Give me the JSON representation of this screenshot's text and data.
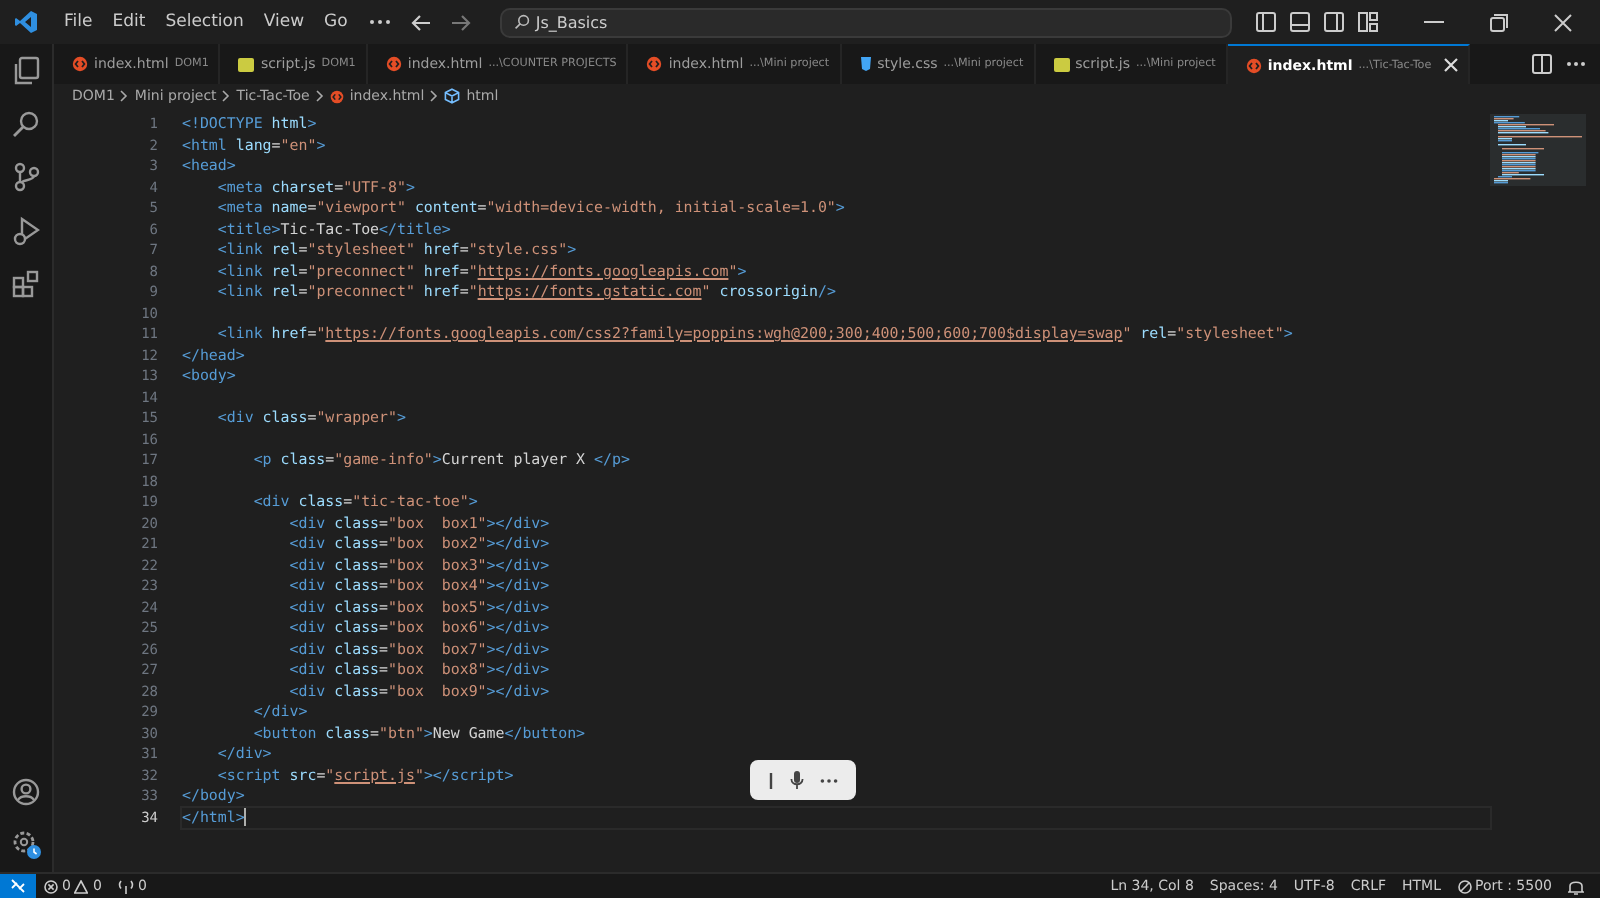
{
  "title_bar": {
    "menus": [
      "File",
      "Edit",
      "Selection",
      "View",
      "Go"
    ],
    "search": {
      "value": "Js_Basics"
    }
  },
  "tabs": [
    {
      "kind": "html",
      "name": "index.html",
      "description": "DOM1",
      "selected": false
    },
    {
      "kind": "js",
      "name": "script.js",
      "description": "DOM1",
      "selected": false
    },
    {
      "kind": "html",
      "name": "index.html",
      "description": "...\\COUNTER PROJECTS",
      "selected": false
    },
    {
      "kind": "html",
      "name": "index.html",
      "description": "...\\Mini project",
      "selected": false
    },
    {
      "kind": "css",
      "name": "style.css",
      "description": "...\\Mini project",
      "selected": false
    },
    {
      "kind": "js",
      "name": "script.js",
      "description": "...\\Mini project",
      "selected": false
    },
    {
      "kind": "html",
      "name": "index.html",
      "description": "...\\Tic-Tac-Toe",
      "selected": true
    }
  ],
  "breadcrumb": [
    {
      "kind": "folder",
      "label": "DOM1"
    },
    {
      "kind": "folder",
      "label": "Mini project"
    },
    {
      "kind": "folder",
      "label": "Tic-Tac-Toe"
    },
    {
      "kind": "html",
      "label": "index.html"
    },
    {
      "kind": "symbol",
      "label": "html"
    }
  ],
  "editor": {
    "lines": [
      {
        "number": "1",
        "current": false,
        "tokens": [
          {
            "kind": "tag",
            "text": "<!DOCTYPE"
          },
          {
            "kind": "attr",
            "text": " html"
          },
          {
            "kind": "tag",
            "text": ">"
          }
        ]
      },
      {
        "number": "2",
        "current": false,
        "tokens": [
          {
            "kind": "tag",
            "text": "<html"
          },
          {
            "kind": "attr",
            "text": " lang"
          },
          {
            "kind": "text",
            "text": "="
          },
          {
            "kind": "str",
            "text": "\"en\""
          },
          {
            "kind": "tag",
            "text": ">"
          }
        ]
      },
      {
        "number": "3",
        "current": false,
        "tokens": [
          {
            "kind": "tag",
            "text": "<head>"
          }
        ]
      },
      {
        "number": "4",
        "current": false,
        "tokens": [
          {
            "kind": "tag",
            "text": "    <meta"
          },
          {
            "kind": "attr",
            "text": " charset"
          },
          {
            "kind": "text",
            "text": "="
          },
          {
            "kind": "str",
            "text": "\"UTF-8\""
          },
          {
            "kind": "tag",
            "text": ">"
          }
        ]
      },
      {
        "number": "5",
        "current": false,
        "tokens": [
          {
            "kind": "tag",
            "text": "    <meta"
          },
          {
            "kind": "attr",
            "text": " name"
          },
          {
            "kind": "text",
            "text": "="
          },
          {
            "kind": "str",
            "text": "\"viewport\""
          },
          {
            "kind": "attr",
            "text": " content"
          },
          {
            "kind": "text",
            "text": "="
          },
          {
            "kind": "str",
            "text": "\"width=device-width, initial-scale=1.0\""
          },
          {
            "kind": "tag",
            "text": ">"
          }
        ]
      },
      {
        "number": "6",
        "current": false,
        "tokens": [
          {
            "kind": "tag",
            "text": "    <title>"
          },
          {
            "kind": "text",
            "text": "Tic-Tac-Toe"
          },
          {
            "kind": "tag",
            "text": "</title>"
          }
        ]
      },
      {
        "number": "7",
        "current": false,
        "tokens": [
          {
            "kind": "tag",
            "text": "    <link"
          },
          {
            "kind": "attr",
            "text": " rel"
          },
          {
            "kind": "text",
            "text": "="
          },
          {
            "kind": "str",
            "text": "\"stylesheet\""
          },
          {
            "kind": "attr",
            "text": " href"
          },
          {
            "kind": "text",
            "text": "="
          },
          {
            "kind": "str",
            "text": "\"style.css\""
          },
          {
            "kind": "tag",
            "text": ">"
          }
        ]
      },
      {
        "number": "8",
        "current": false,
        "tokens": [
          {
            "kind": "tag",
            "text": "    <link"
          },
          {
            "kind": "attr",
            "text": " rel"
          },
          {
            "kind": "text",
            "text": "="
          },
          {
            "kind": "str",
            "text": "\"preconnect\""
          },
          {
            "kind": "attr",
            "text": " href"
          },
          {
            "kind": "text",
            "text": "="
          },
          {
            "kind": "str",
            "text": "\""
          },
          {
            "kind": "link",
            "text": "https://fonts.googleapis.com"
          },
          {
            "kind": "str",
            "text": "\""
          },
          {
            "kind": "tag",
            "text": ">"
          }
        ]
      },
      {
        "number": "9",
        "current": false,
        "tokens": [
          {
            "kind": "tag",
            "text": "    <link"
          },
          {
            "kind": "attr",
            "text": " rel"
          },
          {
            "kind": "text",
            "text": "="
          },
          {
            "kind": "str",
            "text": "\"preconnect\""
          },
          {
            "kind": "attr",
            "text": " href"
          },
          {
            "kind": "text",
            "text": "="
          },
          {
            "kind": "str",
            "text": "\""
          },
          {
            "kind": "link",
            "text": "https://fonts.gstatic.com"
          },
          {
            "kind": "str",
            "text": "\""
          },
          {
            "kind": "attr",
            "text": " crossorigin"
          },
          {
            "kind": "tag",
            "text": "/>"
          }
        ]
      },
      {
        "number": "10",
        "current": false
      },
      {
        "number": "11",
        "current": false,
        "tokens": [
          {
            "kind": "tag",
            "text": "    <link"
          },
          {
            "kind": "attr",
            "text": " href"
          },
          {
            "kind": "text",
            "text": "="
          },
          {
            "kind": "str",
            "text": "\""
          },
          {
            "kind": "link",
            "text": "https://fonts.googleapis.com/css2?family=poppins:wgh@200;300;400;500;600;700$display=swap"
          },
          {
            "kind": "str",
            "text": "\""
          },
          {
            "kind": "attr",
            "text": " rel"
          },
          {
            "kind": "text",
            "text": "="
          },
          {
            "kind": "str",
            "text": "\"stylesheet\""
          },
          {
            "kind": "tag",
            "text": ">"
          }
        ]
      },
      {
        "number": "12",
        "current": false,
        "tokens": [
          {
            "kind": "tag",
            "text": "</head>"
          }
        ]
      },
      {
        "number": "13",
        "current": false,
        "tokens": [
          {
            "kind": "tag",
            "text": "<body>"
          }
        ]
      },
      {
        "number": "14",
        "current": false
      },
      {
        "number": "15",
        "current": false,
        "tokens": [
          {
            "kind": "tag",
            "text": "    <div"
          },
          {
            "kind": "attr",
            "text": " class"
          },
          {
            "kind": "text",
            "text": "="
          },
          {
            "kind": "str",
            "text": "\"wrapper\""
          },
          {
            "kind": "tag",
            "text": ">"
          }
        ]
      },
      {
        "number": "16",
        "current": false
      },
      {
        "number": "17",
        "current": false,
        "tokens": [
          {
            "kind": "tag",
            "text": "        <p"
          },
          {
            "kind": "attr",
            "text": " class"
          },
          {
            "kind": "text",
            "text": "="
          },
          {
            "kind": "str",
            "text": "\"game-info\""
          },
          {
            "kind": "tag",
            "text": ">"
          },
          {
            "kind": "text",
            "text": "Current player X "
          },
          {
            "kind": "tag",
            "text": "</p>"
          }
        ]
      },
      {
        "number": "18",
        "current": false
      },
      {
        "number": "19",
        "current": false,
        "tokens": [
          {
            "kind": "tag",
            "text": "        <div"
          },
          {
            "kind": "attr",
            "text": " class"
          },
          {
            "kind": "text",
            "text": "="
          },
          {
            "kind": "str",
            "text": "\"tic-tac-toe\""
          },
          {
            "kind": "tag",
            "text": ">"
          }
        ]
      },
      {
        "number": "20",
        "current": false,
        "tokens": [
          {
            "kind": "tag",
            "text": "            <div"
          },
          {
            "kind": "attr",
            "text": " class"
          },
          {
            "kind": "text",
            "text": "="
          },
          {
            "kind": "str",
            "text": "\"box  box1\""
          },
          {
            "kind": "tag",
            "text": "></div>"
          }
        ]
      },
      {
        "number": "21",
        "current": false,
        "tokens": [
          {
            "kind": "tag",
            "text": "            <div"
          },
          {
            "kind": "attr",
            "text": " class"
          },
          {
            "kind": "text",
            "text": "="
          },
          {
            "kind": "str",
            "text": "\"box  box2\""
          },
          {
            "kind": "tag",
            "text": "></div>"
          }
        ]
      },
      {
        "number": "22",
        "current": false,
        "tokens": [
          {
            "kind": "tag",
            "text": "            <div"
          },
          {
            "kind": "attr",
            "text": " class"
          },
          {
            "kind": "text",
            "text": "="
          },
          {
            "kind": "str",
            "text": "\"box  box3\""
          },
          {
            "kind": "tag",
            "text": "></div>"
          }
        ]
      },
      {
        "number": "23",
        "current": false,
        "tokens": [
          {
            "kind": "tag",
            "text": "            <div"
          },
          {
            "kind": "attr",
            "text": " class"
          },
          {
            "kind": "text",
            "text": "="
          },
          {
            "kind": "str",
            "text": "\"box  box4\""
          },
          {
            "kind": "tag",
            "text": "></div>"
          }
        ]
      },
      {
        "number": "24",
        "current": false,
        "tokens": [
          {
            "kind": "tag",
            "text": "            <div"
          },
          {
            "kind": "attr",
            "text": " class"
          },
          {
            "kind": "text",
            "text": "="
          },
          {
            "kind": "str",
            "text": "\"box  box5\""
          },
          {
            "kind": "tag",
            "text": "></div>"
          }
        ]
      },
      {
        "number": "25",
        "current": false,
        "tokens": [
          {
            "kind": "tag",
            "text": "            <div"
          },
          {
            "kind": "attr",
            "text": " class"
          },
          {
            "kind": "text",
            "text": "="
          },
          {
            "kind": "str",
            "text": "\"box  box6\""
          },
          {
            "kind": "tag",
            "text": "></div>"
          }
        ]
      },
      {
        "number": "26",
        "current": false,
        "tokens": [
          {
            "kind": "tag",
            "text": "            <div"
          },
          {
            "kind": "attr",
            "text": " class"
          },
          {
            "kind": "text",
            "text": "="
          },
          {
            "kind": "str",
            "text": "\"box  box7\""
          },
          {
            "kind": "tag",
            "text": "></div>"
          }
        ]
      },
      {
        "number": "27",
        "current": false,
        "tokens": [
          {
            "kind": "tag",
            "text": "            <div"
          },
          {
            "kind": "attr",
            "text": " class"
          },
          {
            "kind": "text",
            "text": "="
          },
          {
            "kind": "str",
            "text": "\"box  box8\""
          },
          {
            "kind": "tag",
            "text": "></div>"
          }
        ]
      },
      {
        "number": "28",
        "current": false,
        "tokens": [
          {
            "kind": "tag",
            "text": "            <div"
          },
          {
            "kind": "attr",
            "text": " class"
          },
          {
            "kind": "text",
            "text": "="
          },
          {
            "kind": "str",
            "text": "\"box  box9\""
          },
          {
            "kind": "tag",
            "text": "></div>"
          }
        ]
      },
      {
        "number": "29",
        "current": false,
        "tokens": [
          {
            "kind": "tag",
            "text": "        </div>"
          }
        ]
      },
      {
        "number": "30",
        "current": false,
        "tokens": [
          {
            "kind": "tag",
            "text": "        <button"
          },
          {
            "kind": "attr",
            "text": " class"
          },
          {
            "kind": "text",
            "text": "="
          },
          {
            "kind": "str",
            "text": "\"btn\""
          },
          {
            "kind": "tag",
            "text": ">"
          },
          {
            "kind": "text",
            "text": "New Game"
          },
          {
            "kind": "tag",
            "text": "</button>"
          }
        ]
      },
      {
        "number": "31",
        "current": false,
        "tokens": [
          {
            "kind": "tag",
            "text": "    </div>"
          }
        ]
      },
      {
        "number": "32",
        "current": false,
        "tokens": [
          {
            "kind": "tag",
            "text": "    <script"
          },
          {
            "kind": "attr",
            "text": " src"
          },
          {
            "kind": "text",
            "text": "="
          },
          {
            "kind": "str",
            "text": "\""
          },
          {
            "kind": "link",
            "text": "script.js"
          },
          {
            "kind": "str",
            "text": "\""
          },
          {
            "kind": "tag",
            "text": "></script>"
          }
        ]
      },
      {
        "number": "33",
        "current": false,
        "tokens": [
          {
            "kind": "tag",
            "text": "</body>"
          }
        ]
      },
      {
        "number": "34",
        "current": true,
        "tokens": [
          {
            "kind": "tag",
            "text": "</html>"
          }
        ]
      }
    ]
  },
  "status_bar": {
    "errors": "0",
    "warnings": "0",
    "ports": "0",
    "items": [
      {
        "kind": "text",
        "label": "Ln 34, Col 8"
      },
      {
        "kind": "text",
        "label": "Spaces: 4"
      },
      {
        "kind": "text",
        "label": "UTF-8"
      },
      {
        "kind": "text",
        "label": "CRLF"
      },
      {
        "kind": "text",
        "label": "HTML"
      },
      {
        "kind": "port",
        "label": "Port : 5500"
      }
    ]
  }
}
